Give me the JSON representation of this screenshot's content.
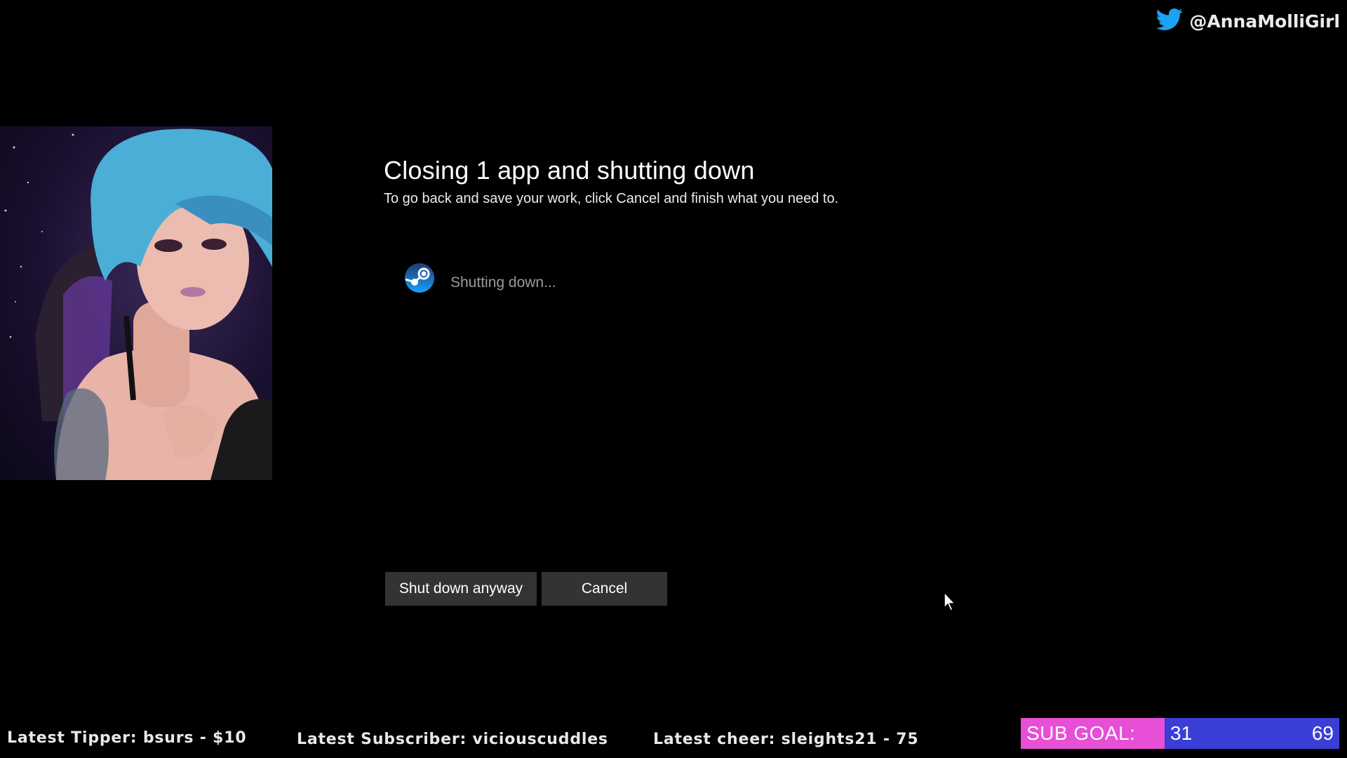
{
  "overlay": {
    "twitter_handle": "@AnnaMolliGirl",
    "latest_tipper": "Latest Tipper: bsurs - $10",
    "latest_subscriber": "Latest Subscriber: viciouscuddles",
    "latest_cheer": "Latest cheer: sleights21 - 75",
    "sub_goal": {
      "label": "SUB GOAL:",
      "current": "31",
      "target": "69"
    },
    "colors": {
      "sub_goal_label_bg": "#e64fd6",
      "sub_goal_bar_bg": "#3a3fd6",
      "twitter_blue": "#1da1f2"
    }
  },
  "dialog": {
    "title": "Closing 1 app and shutting down",
    "subtitle": "To go back and save your work, click Cancel and finish what you need to.",
    "apps": [
      {
        "icon": "steam-icon",
        "status": "Shutting down..."
      }
    ],
    "buttons": {
      "shutdown_anyway": "Shut down anyway",
      "cancel": "Cancel"
    }
  }
}
